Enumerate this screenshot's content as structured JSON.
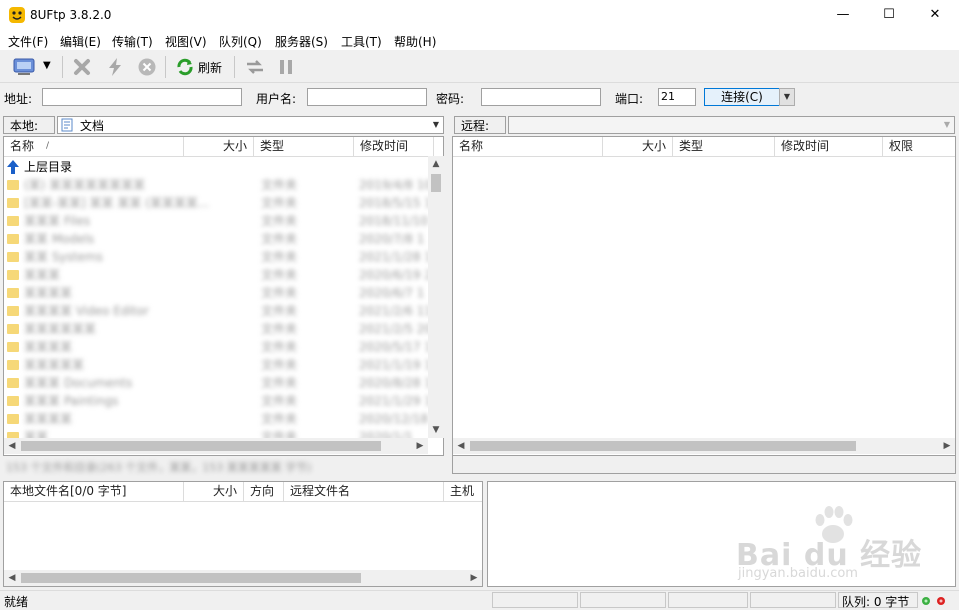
{
  "window": {
    "title": "8UFtp 3.8.2.0",
    "minimize": "—",
    "maximize": "☐",
    "close": "✕"
  },
  "menu": [
    "文件(F)",
    "编辑(E)",
    "传输(T)",
    "视图(V)",
    "队列(Q)",
    "服务器(S)",
    "工具(T)",
    "帮助(H)"
  ],
  "toolbar": {
    "refresh_label": "刷新"
  },
  "connection": {
    "address_label": "地址:",
    "address_value": "",
    "user_label": "用户名:",
    "user_value": "",
    "password_label": "密码:",
    "password_value": "",
    "port_label": "端口:",
    "port_value": "21",
    "connect_label": "连接(C)"
  },
  "local": {
    "label": "本地:",
    "path": "文档",
    "columns": {
      "name": "名称",
      "sort_marker": "/",
      "size": "大小",
      "type": "类型",
      "modified": "修改时间"
    },
    "parent_dir": "上层目录",
    "rows": [
      {
        "name": "(某) 某某某某某某某某",
        "type": "文件夹",
        "modified": "2019/4/8 10"
      },
      {
        "name": "[某某-某某] 某某 某某 (某某某某...",
        "type": "文件夹",
        "modified": "2018/5/15 1"
      },
      {
        "name": "某某某 Files",
        "type": "文件夹",
        "modified": "2018/11/10 1"
      },
      {
        "name": "某某 Models",
        "type": "文件夹",
        "modified": "2020/7/8 1"
      },
      {
        "name": "某某 Systems",
        "type": "文件夹",
        "modified": "2021/1/28 11"
      },
      {
        "name": "某某某",
        "type": "文件夹",
        "modified": "2020/6/19 2"
      },
      {
        "name": "某某某某",
        "type": "文件夹",
        "modified": "2020/6/7 1"
      },
      {
        "name": "某某某某 Video Editor",
        "type": "文件夹",
        "modified": "2021/2/6 11"
      },
      {
        "name": "某某某某某某",
        "type": "文件夹",
        "modified": "2021/2/5 20"
      },
      {
        "name": "某某某某",
        "type": "文件夹",
        "modified": "2020/5/17 1"
      },
      {
        "name": "某某某某某",
        "type": "文件夹",
        "modified": "2021/1/19 1"
      },
      {
        "name": "某某某 Documents",
        "type": "文件夹",
        "modified": "2020/8/28 1"
      },
      {
        "name": "某某某 Paintings",
        "type": "文件夹",
        "modified": "2021/1/29 1"
      },
      {
        "name": "某某某某",
        "type": "文件夹",
        "modified": "2020/12/18"
      },
      {
        "name": "某某",
        "type": "文件夹",
        "modified": "2020/1/1"
      }
    ],
    "status": "153 个文件和目录(263 个文件，某某，153 某某某某某 字节)"
  },
  "remote": {
    "label": "远程:",
    "path": "",
    "columns": {
      "name": "名称",
      "size": "大小",
      "type": "类型",
      "modified": "修改时间",
      "perm": "权限"
    }
  },
  "queue": {
    "columns": {
      "local_file": "本地文件名[0/0 字节]",
      "size": "大小",
      "direction": "方向",
      "remote_file": "远程文件名",
      "host": "主机"
    }
  },
  "statusbar": {
    "status": "就绪",
    "queue": "队列: 0 字节"
  },
  "watermark": {
    "brand": "Bai du 经验",
    "url": "jingyan.baidu.com"
  }
}
